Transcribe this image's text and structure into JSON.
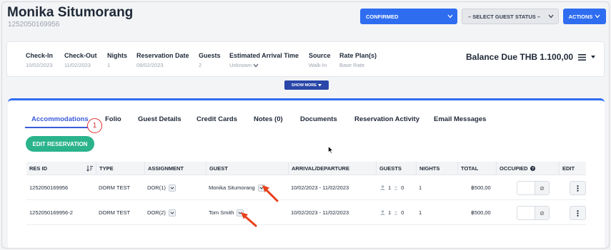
{
  "header": {
    "guest_name": "Monika Situmorang",
    "reservation_number": "1252050169956",
    "status_button": "CONFIRMED",
    "guest_status_button": "– SELECT GUEST STATUS –",
    "actions_button": "ACTIONS"
  },
  "summary": {
    "checkin": {
      "label": "Check-In",
      "value": "10/02/2023"
    },
    "checkout": {
      "label": "Check-Out",
      "value": "11/02/2023"
    },
    "nights": {
      "label": "Nights",
      "value": "1"
    },
    "res_date": {
      "label": "Reservation Date",
      "value": "09/02/2023"
    },
    "guests": {
      "label": "Guests",
      "value": "2"
    },
    "eta": {
      "label": "Estimated Arrival Time",
      "value": "Unknown"
    },
    "source": {
      "label": "Source",
      "value": "Walk-In"
    },
    "rate_plan": {
      "label": "Rate Plan(s)",
      "value": "Base Rate"
    },
    "balance": "Balance Due THB 1.100,00"
  },
  "show_more": "SHOW MORE",
  "tabs": [
    {
      "label": "Accommodations"
    },
    {
      "label": "Folio"
    },
    {
      "label": "Guest Details"
    },
    {
      "label": "Credit Cards"
    },
    {
      "label": "Notes (0)"
    },
    {
      "label": "Documents"
    },
    {
      "label": "Reservation Activity"
    },
    {
      "label": "Email Messages"
    }
  ],
  "step_badge": "1",
  "edit_reservation": "EDIT RESERVATION",
  "table": {
    "columns": [
      "RES ID",
      "TYPE",
      "ASSIGNMENT",
      "GUEST",
      "ARRIVAL/DEPARTURE",
      "GUESTS",
      "NIGHTS",
      "TOTAL",
      "OCCUPIED",
      "EDIT"
    ],
    "rows": [
      {
        "res_id": "1252050169956",
        "type": "DORM TEST",
        "assignment": "DOR(1)",
        "guest": "Monika Situmorang",
        "dates": "10/02/2023 - 11/02/2023",
        "adults": "1",
        "children": "0",
        "nights": "1",
        "total": "฿500,00"
      },
      {
        "res_id": "1252050169956-2",
        "type": "DORM TEST",
        "assignment": "DOR(2)",
        "guest": "Tom Smith",
        "dates": "10/02/2023 - 11/02/2023",
        "adults": "1",
        "children": "0",
        "nights": "1",
        "total": "฿500,00"
      }
    ]
  },
  "colors": {
    "primary": "#2f6df0",
    "accent_green": "#2bb38c",
    "annotation_red": "#e03131",
    "tab_active": "#3b5bdb"
  }
}
